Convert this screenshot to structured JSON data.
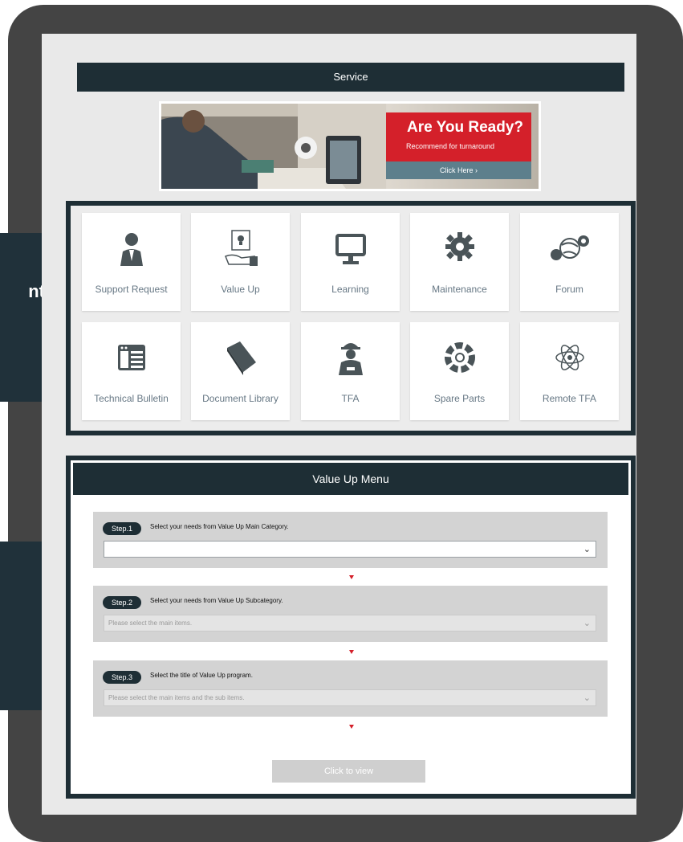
{
  "callouts": {
    "top_text": "nt",
    "bottom_text": ""
  },
  "service": {
    "title": "Service",
    "banner": {
      "headline": "Are You Ready?",
      "subline": "Recommend for turnaround",
      "button": "Click Here ›"
    },
    "tiles": [
      {
        "label": "Support Request",
        "icon": "person-suit-icon"
      },
      {
        "label": "Value Up",
        "icon": "lightbulb-hand-icon"
      },
      {
        "label": "Learning",
        "icon": "monitor-icon"
      },
      {
        "label": "Maintenance",
        "icon": "gear-icon"
      },
      {
        "label": "Forum",
        "icon": "globe-chat-icon"
      },
      {
        "label": "Technical Bulletin",
        "icon": "bulletin-icon"
      },
      {
        "label": "Document Library",
        "icon": "book-icon"
      },
      {
        "label": "TFA",
        "icon": "technician-icon"
      },
      {
        "label": "Spare Parts",
        "icon": "parts-ring-icon"
      },
      {
        "label": "Remote TFA",
        "icon": "atom-icon"
      }
    ]
  },
  "value_up_menu": {
    "title": "Value Up Menu",
    "steps": [
      {
        "badge": "Step.1",
        "text": "Select your needs from Value Up Main Category.",
        "select_value": "",
        "disabled": false
      },
      {
        "badge": "Step.2",
        "text": "Select your needs from Value Up Subcategory.",
        "select_value": "Please select the main items.",
        "disabled": true
      },
      {
        "badge": "Step.3",
        "text": "Select the title of Value Up program.",
        "select_value": "Please select the main items and the sub items.",
        "disabled": true
      }
    ],
    "view_button": "Click to view"
  },
  "colors": {
    "dark": "#1e2e35",
    "accent_red": "#d4202a",
    "tile_label": "#667784",
    "bezel": "#444444"
  }
}
